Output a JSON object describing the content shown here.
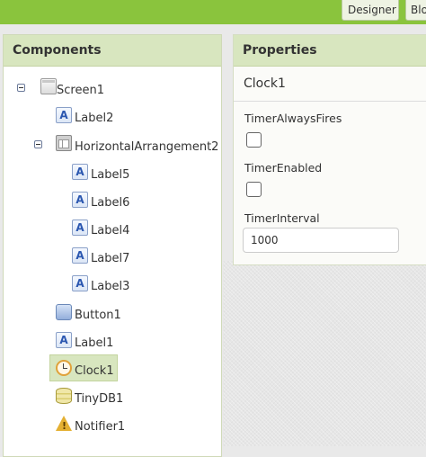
{
  "topbar": {
    "designer_label": "Designer",
    "blocks_label": "Blocks"
  },
  "components": {
    "title": "Components",
    "items": [
      {
        "label": "Screen1",
        "icon": "screen-icon"
      },
      {
        "label": "Label2",
        "icon": "label-icon"
      },
      {
        "label": "HorizontalArrangement2",
        "icon": "horizontal-arrangement-icon"
      },
      {
        "label": "Label5",
        "icon": "label-icon"
      },
      {
        "label": "Label6",
        "icon": "label-icon"
      },
      {
        "label": "Label4",
        "icon": "label-icon"
      },
      {
        "label": "Label7",
        "icon": "label-icon"
      },
      {
        "label": "Label3",
        "icon": "label-icon"
      },
      {
        "label": "Button1",
        "icon": "button-icon"
      },
      {
        "label": "Label1",
        "icon": "label-icon"
      },
      {
        "label": "Clock1",
        "icon": "clock-icon",
        "selected": true
      },
      {
        "label": "TinyDB1",
        "icon": "database-icon"
      },
      {
        "label": "Notifier1",
        "icon": "warning-icon"
      }
    ]
  },
  "properties": {
    "title": "Properties",
    "component": "Clock1",
    "timer_always_fires": {
      "label": "TimerAlwaysFires",
      "checked": false
    },
    "timer_enabled": {
      "label": "TimerEnabled",
      "checked": false
    },
    "timer_interval": {
      "label": "TimerInterval",
      "value": "1000"
    }
  },
  "colors": {
    "topbar": "#8ac43d",
    "panel_header": "#d8e6bf",
    "selection": "#d8e6bf"
  }
}
